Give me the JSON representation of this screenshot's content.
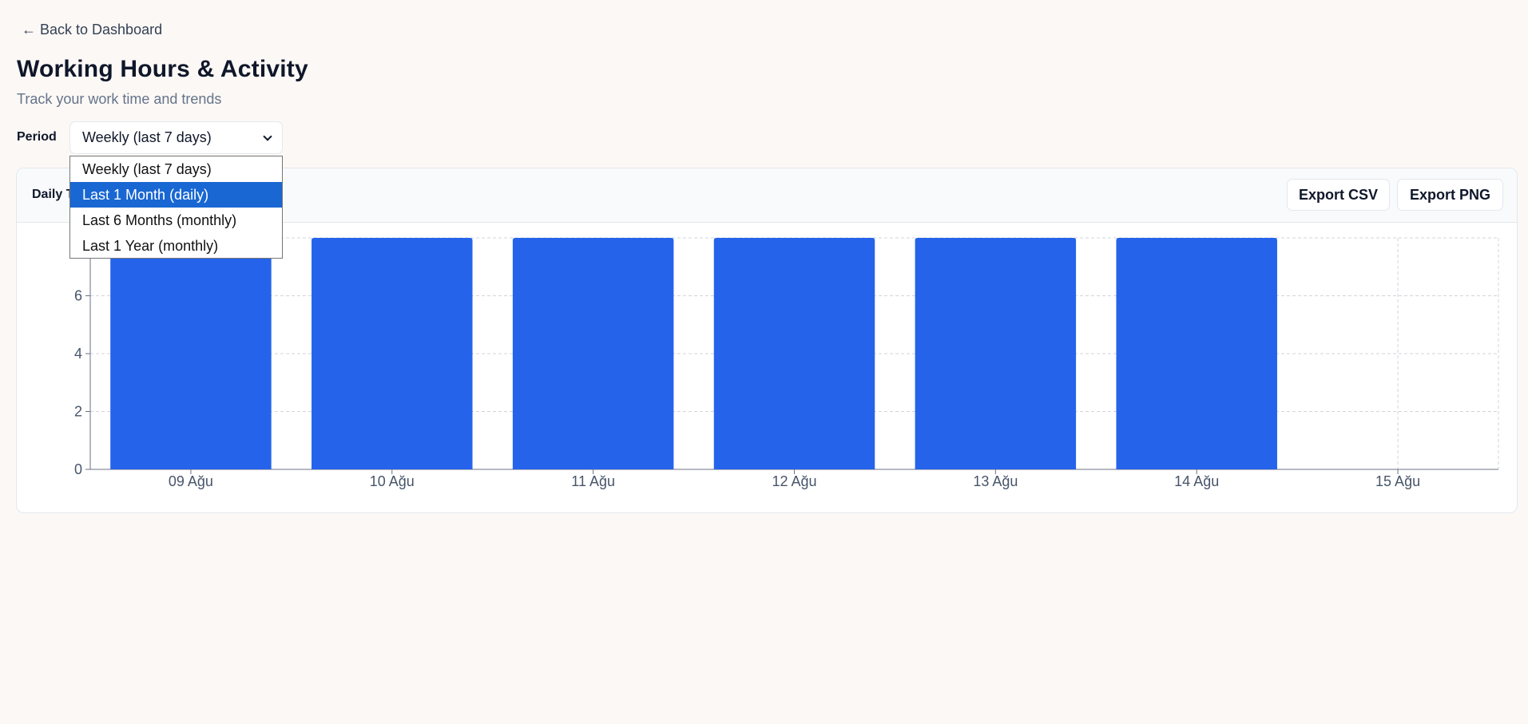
{
  "nav": {
    "back_label": "← Back to Dashboard"
  },
  "header": {
    "title": "Working Hours & Activity",
    "subtitle": "Track your work time and trends"
  },
  "period": {
    "label": "Period",
    "selected": "Weekly (last 7 days)",
    "options": [
      "Weekly (last 7 days)",
      "Last 1 Month (daily)",
      "Last 6 Months (monthly)",
      "Last 1 Year (monthly)"
    ],
    "highlighted_index": 1
  },
  "card": {
    "title": "Daily T",
    "export_csv_label": "Export CSV",
    "export_png_label": "Export PNG"
  },
  "colors": {
    "bar": "#2563eb",
    "dropdown_highlight": "#1967d2",
    "background": "#fcf8f5"
  },
  "chart_data": {
    "type": "bar",
    "title": "",
    "xlabel": "",
    "ylabel": "",
    "categories": [
      "09 Ağu",
      "10 Ağu",
      "11 Ağu",
      "12 Ağu",
      "13 Ağu",
      "14 Ağu",
      "15 Ağu"
    ],
    "values": [
      8,
      8,
      8,
      8,
      8,
      8,
      0
    ],
    "ylim": [
      0,
      8
    ],
    "y_ticks": [
      0,
      2,
      4,
      6
    ],
    "grid": true,
    "legend": "none"
  }
}
